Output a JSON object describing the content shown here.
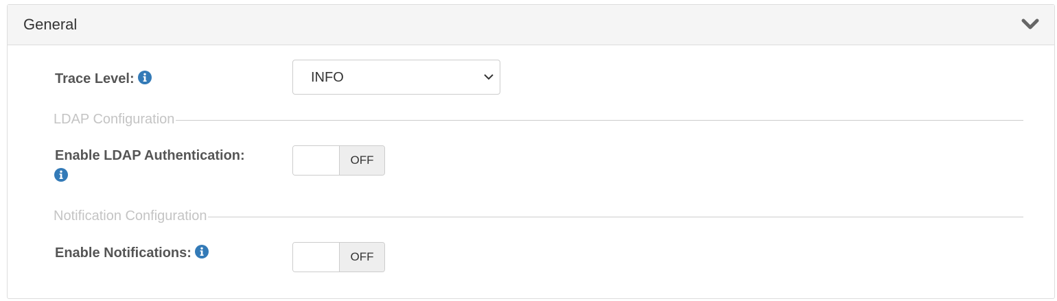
{
  "panel": {
    "title": "General"
  },
  "fields": {
    "trace_level": {
      "label": "Trace Level:",
      "value": "INFO"
    },
    "ldap_section": "LDAP Configuration",
    "ldap_auth": {
      "label": "Enable LDAP Authentication:",
      "state": "OFF"
    },
    "notification_section": "Notification Configuration",
    "notifications": {
      "label": "Enable Notifications:",
      "state": "OFF"
    }
  },
  "colors": {
    "info_icon": "#337ab7",
    "label": "#555555",
    "legend": "#c4c4c4",
    "heading_bg": "#f5f5f5"
  },
  "icons": {
    "collapse": "chevron-down-icon",
    "info": "info-icon",
    "select_caret": "caret-down-icon"
  }
}
